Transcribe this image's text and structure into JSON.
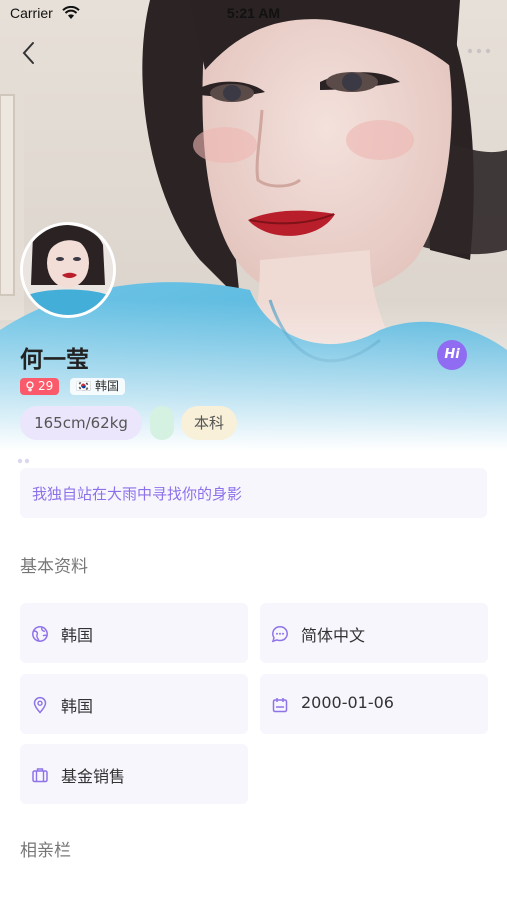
{
  "status_bar": {
    "carrier": "Carrier",
    "time": "5:21 AM"
  },
  "profile": {
    "name": "何一莹",
    "age": "29",
    "country": "韩国",
    "flag": "🇰🇷",
    "tags": {
      "height_weight": "165cm/62kg",
      "education": "本科"
    },
    "greet_label": "Hi",
    "bio": "我独自站在大雨中寻找你的身影"
  },
  "basic_info": {
    "title": "基本资料",
    "items": [
      {
        "icon": "globe-icon",
        "label": "韩国"
      },
      {
        "icon": "chat-icon",
        "label": "简体中文"
      },
      {
        "icon": "location-pin-icon",
        "label": "韩国"
      },
      {
        "icon": "calendar-icon",
        "label": "2000-01-06"
      },
      {
        "icon": "briefcase-icon",
        "label": "基金销售"
      }
    ]
  },
  "dating_section": {
    "title": "相亲栏"
  },
  "colors": {
    "accent": "#8f6cf2",
    "icon": "#8f73e8",
    "card_bg": "#f7f6fd",
    "age_badge": "#fb5a6a"
  }
}
